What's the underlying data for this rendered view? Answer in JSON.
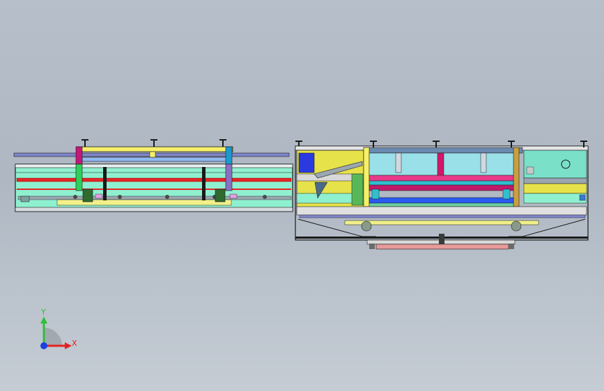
{
  "viewport": {
    "background_top": "#b7bfca",
    "background_bottom": "#c5ccd4"
  },
  "model": {
    "left_module": "conveyor-section",
    "right_module": "processing-station"
  },
  "triad": {
    "y_label": "Y",
    "x_label": "X",
    "y_color": "#2fbf3a",
    "x_color": "#e02424",
    "origin_color": "#1d3fe0"
  }
}
